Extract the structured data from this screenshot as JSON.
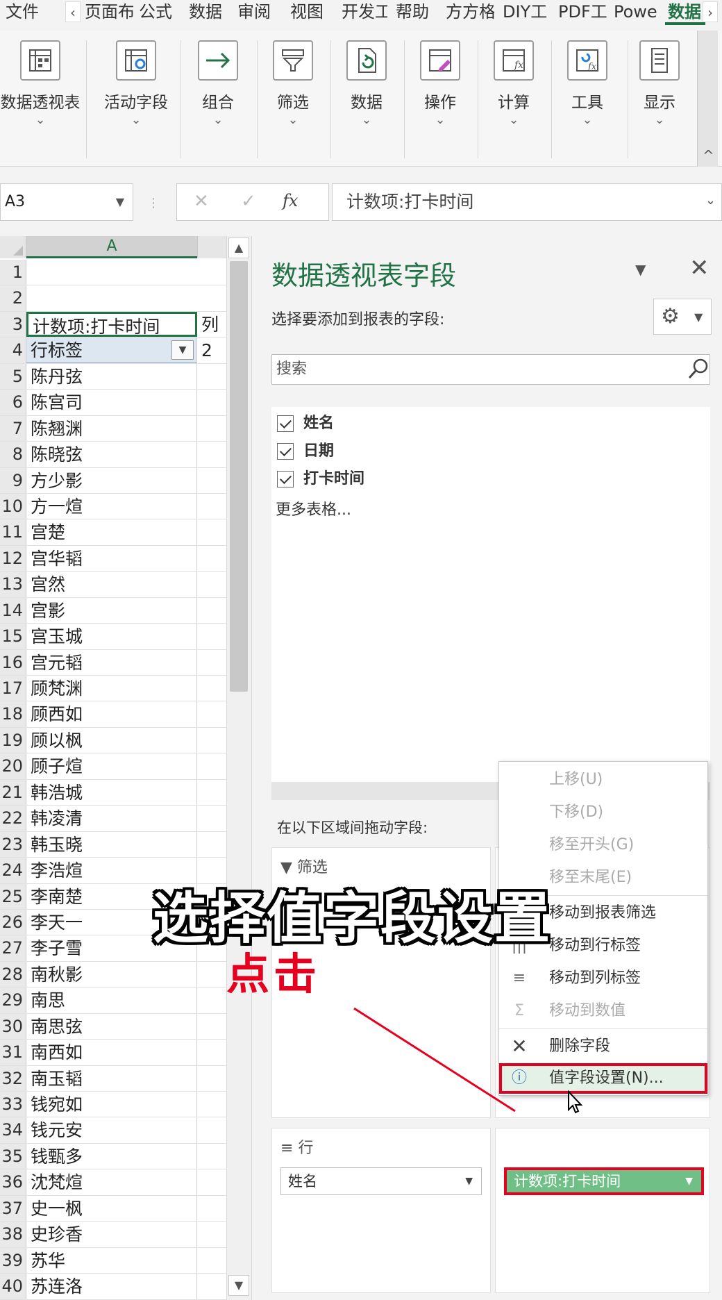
{
  "tabs": [
    {
      "label": "文件",
      "active": false
    },
    {
      "label": "页面布",
      "active": false
    },
    {
      "label": "公式",
      "active": false
    },
    {
      "label": "数据",
      "active": false
    },
    {
      "label": "审阅",
      "active": false
    },
    {
      "label": "视图",
      "active": false
    },
    {
      "label": "开发工",
      "active": false
    },
    {
      "label": "帮助",
      "active": false
    },
    {
      "label": "方方格",
      "active": false
    },
    {
      "label": "DIY工",
      "active": false
    },
    {
      "label": "PDF工",
      "active": false
    },
    {
      "label": "Powe",
      "active": false
    },
    {
      "label": "数据",
      "active": true
    }
  ],
  "ribbon": {
    "groups": [
      {
        "label": "数据透视表",
        "icon": "pivot-table-icon"
      },
      {
        "label": "活动字段",
        "icon": "active-field-icon"
      },
      {
        "label": "组合",
        "icon": "group-arrow-icon"
      },
      {
        "label": "筛选",
        "icon": "filter-icon"
      },
      {
        "label": "数据",
        "icon": "refresh-data-icon"
      },
      {
        "label": "操作",
        "icon": "actions-icon"
      },
      {
        "label": "计算",
        "icon": "calculate-icon"
      },
      {
        "label": "工具",
        "icon": "tools-icon"
      },
      {
        "label": "显示",
        "icon": "show-icon"
      }
    ]
  },
  "formula_bar": {
    "name_box": "A3",
    "fx_label": "fx",
    "formula": "计数项:打卡时间"
  },
  "sheet": {
    "column_a": "A",
    "rows": [
      {
        "num": "1",
        "a": "",
        "b": ""
      },
      {
        "num": "2",
        "a": "",
        "b": ""
      },
      {
        "num": "3",
        "a": "计数项:打卡时间",
        "b": "列"
      },
      {
        "num": "4",
        "a": "行标签",
        "b": "2"
      },
      {
        "num": "5",
        "a": "陈丹弦",
        "b": ""
      },
      {
        "num": "6",
        "a": "陈宫司",
        "b": ""
      },
      {
        "num": "7",
        "a": "陈翘渊",
        "b": ""
      },
      {
        "num": "8",
        "a": "陈晓弦",
        "b": ""
      },
      {
        "num": "9",
        "a": "方少影",
        "b": ""
      },
      {
        "num": "10",
        "a": "方一煊",
        "b": ""
      },
      {
        "num": "11",
        "a": "宫楚",
        "b": ""
      },
      {
        "num": "12",
        "a": "宫华韬",
        "b": ""
      },
      {
        "num": "13",
        "a": "宫然",
        "b": ""
      },
      {
        "num": "14",
        "a": "宫影",
        "b": ""
      },
      {
        "num": "15",
        "a": "宫玉城",
        "b": ""
      },
      {
        "num": "16",
        "a": "宫元韬",
        "b": ""
      },
      {
        "num": "17",
        "a": "顾梵渊",
        "b": ""
      },
      {
        "num": "18",
        "a": "顾西如",
        "b": ""
      },
      {
        "num": "19",
        "a": "顾以枫",
        "b": ""
      },
      {
        "num": "20",
        "a": "顾子煊",
        "b": ""
      },
      {
        "num": "21",
        "a": "韩浩城",
        "b": ""
      },
      {
        "num": "22",
        "a": "韩凌清",
        "b": ""
      },
      {
        "num": "23",
        "a": "韩玉晓",
        "b": ""
      },
      {
        "num": "24",
        "a": "李浩煊",
        "b": ""
      },
      {
        "num": "25",
        "a": "李南楚",
        "b": ""
      },
      {
        "num": "26",
        "a": "李天一",
        "b": ""
      },
      {
        "num": "27",
        "a": "李子雪",
        "b": ""
      },
      {
        "num": "28",
        "a": "南秋影",
        "b": ""
      },
      {
        "num": "29",
        "a": "南思",
        "b": ""
      },
      {
        "num": "30",
        "a": "南思弦",
        "b": ""
      },
      {
        "num": "31",
        "a": "南西如",
        "b": ""
      },
      {
        "num": "32",
        "a": "南玉韬",
        "b": ""
      },
      {
        "num": "33",
        "a": "钱宛如",
        "b": ""
      },
      {
        "num": "34",
        "a": "钱元安",
        "b": ""
      },
      {
        "num": "35",
        "a": "钱甄多",
        "b": ""
      },
      {
        "num": "36",
        "a": "沈梵煊",
        "b": ""
      },
      {
        "num": "37",
        "a": "史一枫",
        "b": ""
      },
      {
        "num": "38",
        "a": "史珍香",
        "b": ""
      },
      {
        "num": "39",
        "a": "苏华",
        "b": ""
      },
      {
        "num": "40",
        "a": "苏连洛",
        "b": ""
      }
    ]
  },
  "pane": {
    "title": "数据透视表字段",
    "subtitle": "选择要添加到报表的字段:",
    "search_placeholder": "搜索",
    "fields": [
      "姓名",
      "日期",
      "打卡时间"
    ],
    "more_tables": "更多表格...",
    "drag_label": "在以下区域间拖动字段:",
    "area_filter": "筛选",
    "area_rows": "行",
    "rows_pill": "姓名",
    "values_pill": "计数项:打卡时间"
  },
  "context_menu": {
    "items": [
      {
        "label": "上移(U)",
        "disabled": true,
        "icon": ""
      },
      {
        "label": "下移(D)",
        "disabled": true,
        "icon": ""
      },
      {
        "label": "移至开头(G)",
        "disabled": true,
        "icon": ""
      },
      {
        "label": "移至末尾(E)",
        "disabled": true,
        "icon": ""
      },
      {
        "label": "移动到报表筛选",
        "disabled": false,
        "icon": "filter-move-icon"
      },
      {
        "label": "移动到行标签",
        "disabled": false,
        "icon": "row-labels-icon"
      },
      {
        "label": "移动到列标签",
        "disabled": false,
        "icon": "column-labels-icon"
      },
      {
        "label": "移动到数值",
        "disabled": true,
        "icon": "sigma-icon"
      },
      {
        "label": "删除字段",
        "disabled": false,
        "icon": "delete-x-icon"
      },
      {
        "label": "值字段设置(N)...",
        "disabled": false,
        "icon": "field-settings-icon"
      }
    ]
  },
  "overlay": {
    "caption": "选择值字段设置",
    "click_label": "点击"
  },
  "colors": {
    "accent": "#217346",
    "highlight_red": "#e6001f",
    "values_pill": "#6fbf86"
  }
}
